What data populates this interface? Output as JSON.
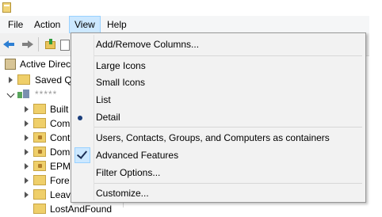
{
  "menubar": {
    "items": [
      "File",
      "Action",
      "View",
      "Help"
    ],
    "active": "View"
  },
  "tree": {
    "root_label": "Active Direc",
    "saved_queries": "Saved Q",
    "domain_label": "*****",
    "children": [
      "Built",
      "Com",
      "Cont",
      "Dom",
      "EPM",
      "Fore",
      "Leav",
      "LostAndFound"
    ]
  },
  "view_menu": {
    "add_remove_columns": "Add/Remove Columns...",
    "large_icons": "Large Icons",
    "small_icons": "Small Icons",
    "list": "List",
    "detail": "Detail",
    "containers_option": "Users, Contacts, Groups, and Computers as containers",
    "advanced_features": "Advanced Features",
    "filter_options": "Filter Options...",
    "customize": "Customize...",
    "selected_view": "Detail",
    "advanced_features_checked": true
  },
  "icons": {
    "back": "arrow-left-icon",
    "forward": "arrow-right-icon",
    "up": "folder-up-icon",
    "console_tree": "console-tree-icon"
  },
  "colors": {
    "menu_highlight": "#cce8ff",
    "menu_highlight_border": "#99d1ff",
    "menu_background": "#f2f2f2"
  }
}
